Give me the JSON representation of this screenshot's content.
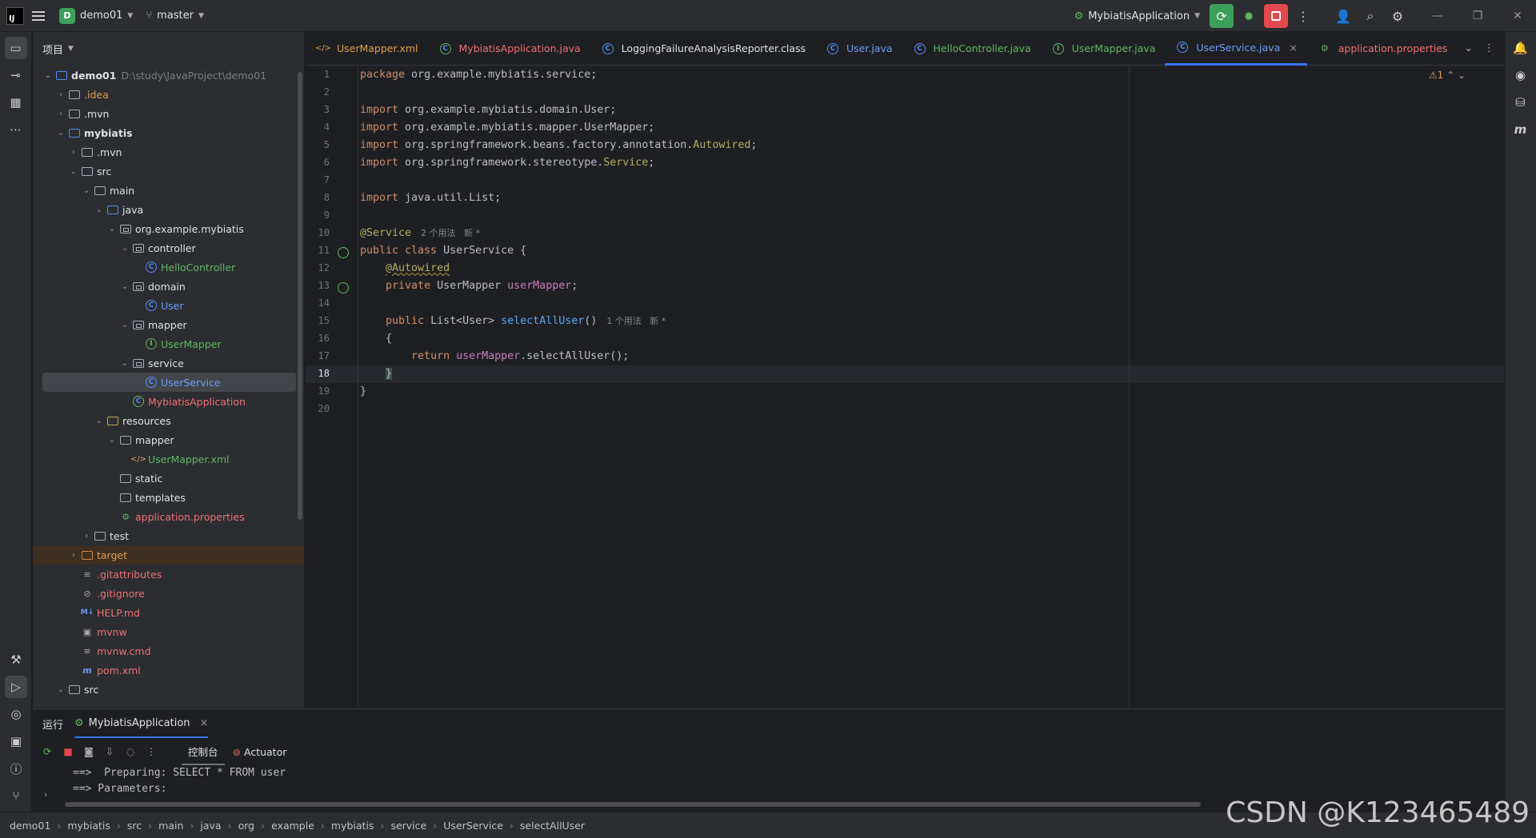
{
  "titlebar": {
    "project_badge": "D",
    "project_name": "demo01",
    "branch": "master",
    "run_config": "MybiatisApplication"
  },
  "project_panel": {
    "title": "项目",
    "tree": [
      {
        "label": "demo01",
        "path": "D:\\study\\JavaProject\\demo01",
        "indent": 0,
        "chev": "v",
        "icon": "module-folder",
        "style": "bold"
      },
      {
        "label": ".idea",
        "indent": 1,
        "chev": ">",
        "icon": "folder",
        "style": "orange"
      },
      {
        "label": ".mvn",
        "indent": 1,
        "chev": ">",
        "icon": "folder",
        "style": ""
      },
      {
        "label": "mybiatis",
        "indent": 1,
        "chev": "v",
        "icon": "module-folder",
        "style": "bold"
      },
      {
        "label": ".mvn",
        "indent": 2,
        "chev": ">",
        "icon": "folder",
        "style": ""
      },
      {
        "label": "src",
        "indent": 2,
        "chev": "v",
        "icon": "folder",
        "style": ""
      },
      {
        "label": "main",
        "indent": 3,
        "chev": "v",
        "icon": "folder",
        "style": ""
      },
      {
        "label": "java",
        "indent": 4,
        "chev": "v",
        "icon": "source-folder",
        "style": ""
      },
      {
        "label": "org.example.mybiatis",
        "indent": 5,
        "chev": "v",
        "icon": "package",
        "style": ""
      },
      {
        "label": "controller",
        "indent": 6,
        "chev": "v",
        "icon": "package",
        "style": ""
      },
      {
        "label": "HelloController",
        "indent": 7,
        "chev": "",
        "icon": "class",
        "style": "green"
      },
      {
        "label": "domain",
        "indent": 6,
        "chev": "v",
        "icon": "package",
        "style": ""
      },
      {
        "label": "User",
        "indent": 7,
        "chev": "",
        "icon": "class",
        "style": "blue"
      },
      {
        "label": "mapper",
        "indent": 6,
        "chev": "v",
        "icon": "package",
        "style": ""
      },
      {
        "label": "UserMapper",
        "indent": 7,
        "chev": "",
        "icon": "interface",
        "style": "green"
      },
      {
        "label": "service",
        "indent": 6,
        "chev": "v",
        "icon": "package",
        "style": ""
      },
      {
        "label": "UserService",
        "indent": 7,
        "chev": "",
        "icon": "class",
        "style": "blue",
        "selected": true
      },
      {
        "label": "MybiatisApplication",
        "indent": 6,
        "chev": "",
        "icon": "spring-class",
        "style": "red"
      },
      {
        "label": "resources",
        "indent": 4,
        "chev": "v",
        "icon": "resource-folder",
        "style": ""
      },
      {
        "label": "mapper",
        "indent": 5,
        "chev": "v",
        "icon": "folder",
        "style": ""
      },
      {
        "label": "UserMapper.xml",
        "indent": 6,
        "chev": "",
        "icon": "xml",
        "style": "green"
      },
      {
        "label": "static",
        "indent": 5,
        "chev": "",
        "icon": "folder",
        "style": ""
      },
      {
        "label": "templates",
        "indent": 5,
        "chev": "",
        "icon": "folder",
        "style": ""
      },
      {
        "label": "application.properties",
        "indent": 5,
        "chev": "",
        "icon": "properties",
        "style": "red"
      },
      {
        "label": "test",
        "indent": 3,
        "chev": ">",
        "icon": "folder",
        "style": ""
      },
      {
        "label": "target",
        "indent": 2,
        "chev": ">",
        "icon": "folder-orange",
        "style": "orange",
        "target": true
      },
      {
        "label": ".gitattributes",
        "indent": 2,
        "chev": "",
        "icon": "text-file",
        "style": "red"
      },
      {
        "label": ".gitignore",
        "indent": 2,
        "chev": "",
        "icon": "ignore-file",
        "style": "red"
      },
      {
        "label": "HELP.md",
        "indent": 2,
        "chev": "",
        "icon": "markdown",
        "style": "red"
      },
      {
        "label": "mvnw",
        "indent": 2,
        "chev": "",
        "icon": "shell",
        "style": "red"
      },
      {
        "label": "mvnw.cmd",
        "indent": 2,
        "chev": "",
        "icon": "text-file",
        "style": "red"
      },
      {
        "label": "pom.xml",
        "indent": 2,
        "chev": "",
        "icon": "maven",
        "style": "red"
      },
      {
        "label": "src",
        "indent": 1,
        "chev": "v",
        "icon": "folder",
        "style": ""
      }
    ]
  },
  "tabs": [
    {
      "label": "UserMapper.xml",
      "icon": "xml",
      "style": "orange"
    },
    {
      "label": "MybiatisApplication.java",
      "icon": "spring-class",
      "style": "red"
    },
    {
      "label": "LoggingFailureAnalysisReporter.class",
      "icon": "class",
      "style": ""
    },
    {
      "label": "User.java",
      "icon": "class",
      "style": "blue"
    },
    {
      "label": "HelloController.java",
      "icon": "class",
      "style": "green"
    },
    {
      "label": "UserMapper.java",
      "icon": "interface",
      "style": "green"
    },
    {
      "label": "UserService.java",
      "icon": "class",
      "style": "blue",
      "active": true,
      "close": "×"
    },
    {
      "label": "application.properties",
      "icon": "properties",
      "style": "red"
    }
  ],
  "editor": {
    "warning_count": "⚠1",
    "current_line": "18",
    "line_numbers": [
      "1",
      "2",
      "3",
      "4",
      "5",
      "6",
      "7",
      "8",
      "9",
      "10",
      "11",
      "12",
      "13",
      "14",
      "15",
      "16",
      "17",
      "18",
      "19",
      "20"
    ],
    "code": {
      "l1_kw": "package",
      "l1_rest": " org.example.mybiatis.service;",
      "l3_kw": "import",
      "l3_rest": " org.example.mybiatis.domain.User;",
      "l4_kw": "import",
      "l4_rest": " org.example.mybiatis.mapper.UserMapper;",
      "l5_kw": "import",
      "l5_rest": " org.springframework.beans.factory.annotation.",
      "l5_ann": "Autowired",
      "l5_end": ";",
      "l6_kw": "import",
      "l6_rest": " org.springframework.stereotype.",
      "l6_ann": "Service",
      "l6_end": ";",
      "l8_kw": "import",
      "l8_rest": " java.util.List;",
      "l10_ann": "@Service",
      "l10_hint": "2 个用法   新 *",
      "l11_kw": "public class",
      "l11_rest": " UserService {",
      "l12_ann": "@Autowired",
      "l13_kw": "private",
      "l13_type": " UserMapper ",
      "l13_fld": "userMapper",
      "l13_end": ";",
      "l15_kw": "public",
      "l15_type": " List<User> ",
      "l15_fn": "selectAllUser",
      "l15_end": "()",
      "l15_hint": "1 个用法   新 *",
      "l16": "{",
      "l17_kw": "return",
      "l17_fld": "userMapper",
      "l17_rest": ".selectAllUser();",
      "l18": "}",
      "l19": "}"
    }
  },
  "run_panel": {
    "title": "运行",
    "config": "MybiatisApplication",
    "console_tab": "控制台",
    "actuator_tab": "Actuator",
    "lines": [
      "==>  Preparing: SELECT * FROM user",
      "==> Parameters: "
    ]
  },
  "statusbar": {
    "breadcrumbs": [
      "demo01",
      "mybiatis",
      "src",
      "main",
      "java",
      "org",
      "example",
      "mybiatis",
      "service",
      "UserService",
      "selectAllUser"
    ]
  },
  "watermark": "CSDN @K123465489",
  "colors": {
    "accent": "#3574f0",
    "run_green": "#3c9f5c",
    "stop_red": "#e5484d"
  }
}
